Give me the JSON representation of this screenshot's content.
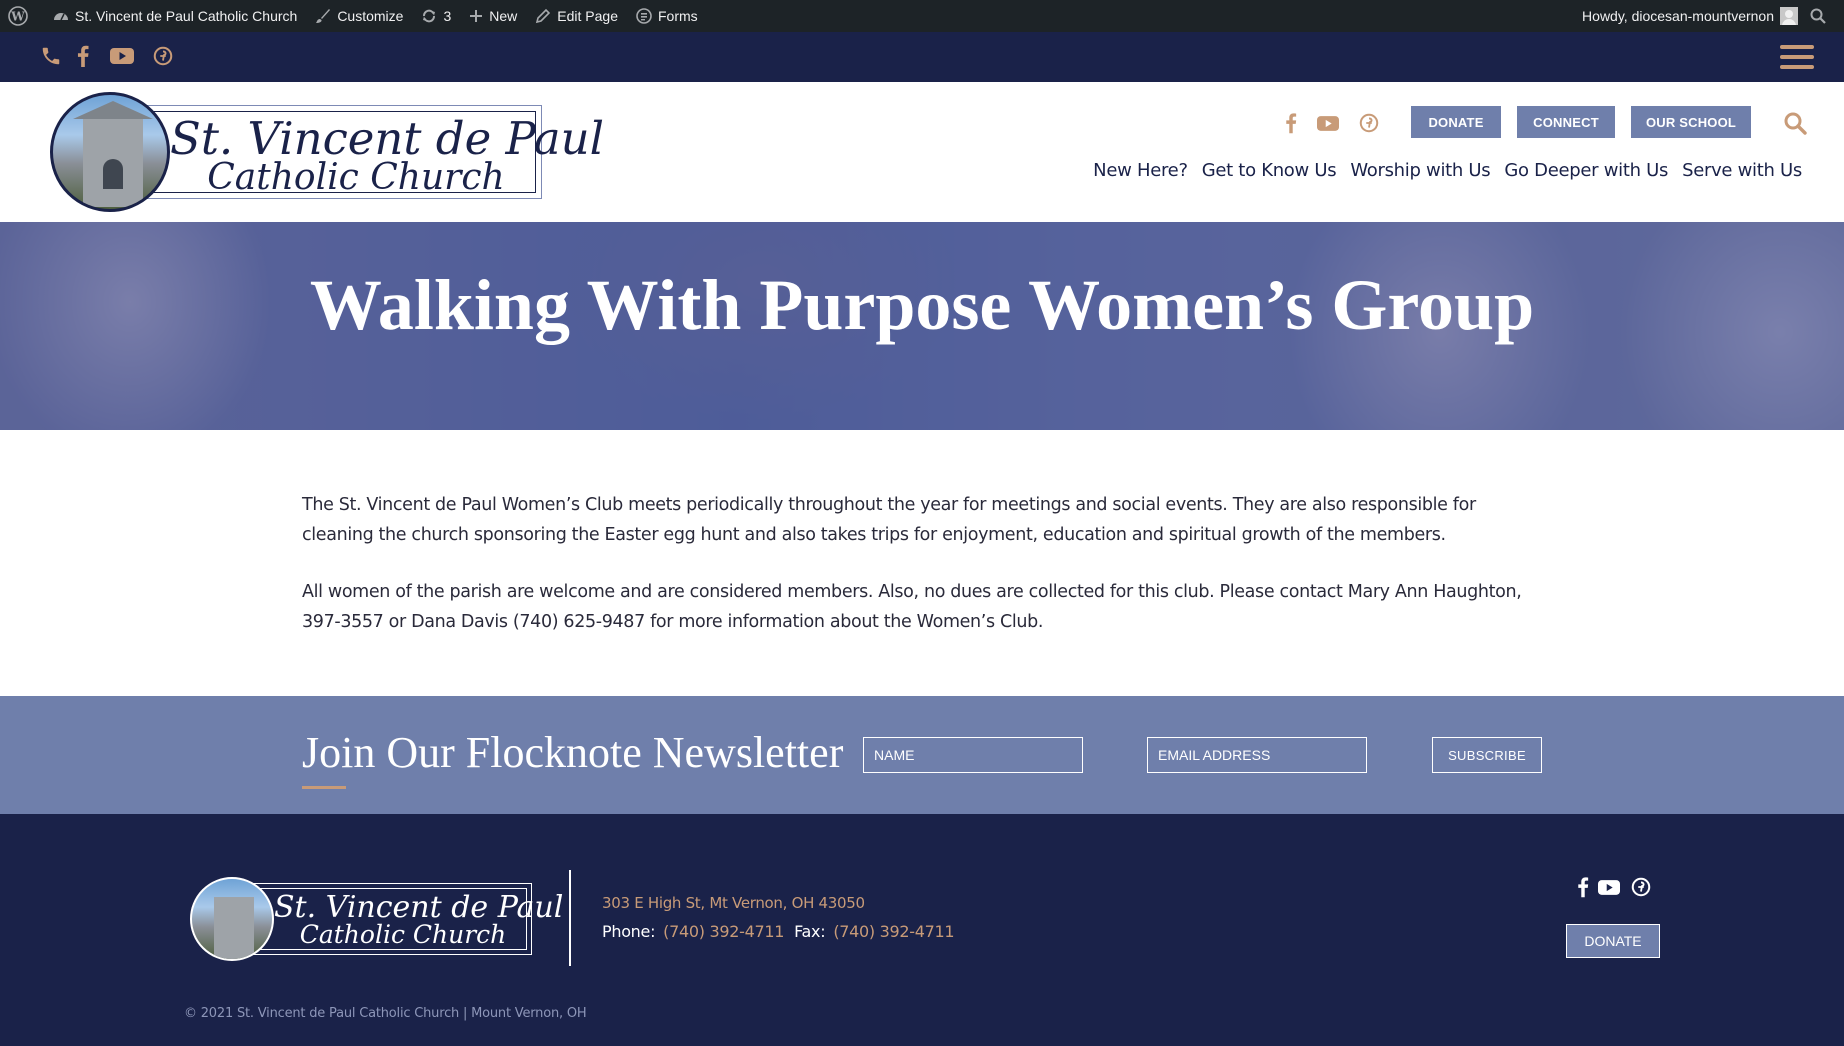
{
  "admin_bar": {
    "site_name": "St. Vincent de Paul Catholic Church",
    "customize": "Customize",
    "updates_count": "3",
    "new": "New",
    "edit_page": "Edit Page",
    "forms": "Forms",
    "howdy": "Howdy, diocesan-mountvernon"
  },
  "logo": {
    "line1": "St. Vincent de Paul",
    "line2": "Catholic Church"
  },
  "header": {
    "buttons": [
      "DONATE",
      "CONNECT",
      "OUR SCHOOL"
    ],
    "nav": [
      "New Here?",
      "Get to Know Us",
      "Worship with Us",
      "Go Deeper with Us",
      "Serve with Us"
    ]
  },
  "hero": {
    "title": "Walking With Purpose Women’s Group"
  },
  "content": {
    "paragraphs": [
      "The St. Vincent de Paul Women’s Club meets periodically throughout the year for meetings and social events. They are also responsible for cleaning the church sponsoring the Easter egg hunt and also takes trips for enjoyment, education and spiritual growth of the members.",
      "All women of the parish are welcome and are considered members. Also, no dues are collected for this club. Please contact Mary Ann Haughton, 397-3557 or Dana Davis (740) 625-9487 for more information about the Women’s Club."
    ]
  },
  "newsletter": {
    "title": "Join Our Flocknote Newsletter",
    "name_placeholder": "NAME",
    "email_placeholder": "EMAIL ADDRESS",
    "subscribe": "SUBSCRIBE"
  },
  "footer": {
    "address": "303 E High St, Mt Vernon, OH 43050",
    "phone_label": "Phone:",
    "phone": "(740) 392-4711",
    "fax_label": "Fax:",
    "fax": "(740) 392-4711",
    "donate": "DONATE",
    "copyright": "© 2021 St. Vincent de Paul Catholic Church | Mount Vernon, OH"
  },
  "colors": {
    "navy": "#1a2249",
    "periwinkle": "#6f7fab",
    "accent": "#c89b78",
    "admin_bar": "#1d2327"
  }
}
